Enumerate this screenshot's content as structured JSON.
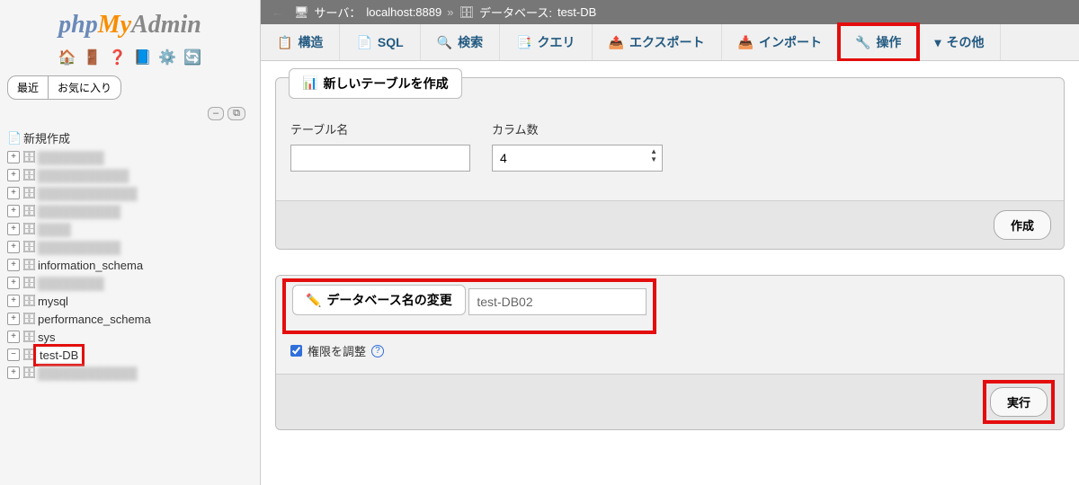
{
  "logo": {
    "php": "php",
    "my": "My",
    "admin": "Admin"
  },
  "sidebar": {
    "recent": "最近",
    "favorites": "お気に入り",
    "new_label": "新規作成",
    "items": [
      {
        "label": "information_schema",
        "clear": true
      },
      {
        "label": "mysql",
        "clear": true
      },
      {
        "label": "performance_schema",
        "clear": true
      },
      {
        "label": "sys",
        "clear": true
      },
      {
        "label": "test-DB",
        "clear": true,
        "selected": true
      }
    ],
    "blurred_count": 7
  },
  "breadcrumb": {
    "server_label": "サーバ：",
    "server_value": "localhost:8889",
    "db_label": "データベース:",
    "db_value": "test-DB"
  },
  "tabs": {
    "structure": "構造",
    "sql": "SQL",
    "search": "検索",
    "query": "クエリ",
    "export": "エクスポート",
    "import": "インポート",
    "operation": "操作",
    "more": "その他"
  },
  "create_table": {
    "title": "新しいテーブルを作成",
    "name_label": "テーブル名",
    "cols_label": "カラム数",
    "cols_value": "4",
    "submit": "作成"
  },
  "rename_db": {
    "title": "データベース名の変更",
    "value": "test-DB02",
    "adjust_priv": "権限を調整",
    "submit": "実行"
  }
}
